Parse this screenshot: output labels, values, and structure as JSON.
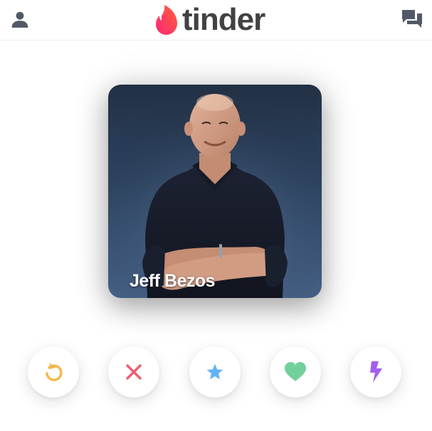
{
  "app": {
    "brand": "tinder",
    "brand_gradient": [
      "#fd267a",
      "#ff6036"
    ]
  },
  "header": {
    "left_icon": "profile-icon",
    "right_icon": "messages-icon",
    "icon_color": "#505965"
  },
  "card": {
    "name": "Jeff Bezos"
  },
  "actions": [
    {
      "name": "rewind",
      "icon": "rewind-icon",
      "color": "#f5b748"
    },
    {
      "name": "nope",
      "icon": "close-icon",
      "color": "#ec5e6f"
    },
    {
      "name": "super-like",
      "icon": "star-icon",
      "color": "#62b4f9"
    },
    {
      "name": "like",
      "icon": "heart-icon",
      "color": "#72d09c"
    },
    {
      "name": "boost",
      "icon": "lightning-icon",
      "color": "#a55dee"
    }
  ]
}
